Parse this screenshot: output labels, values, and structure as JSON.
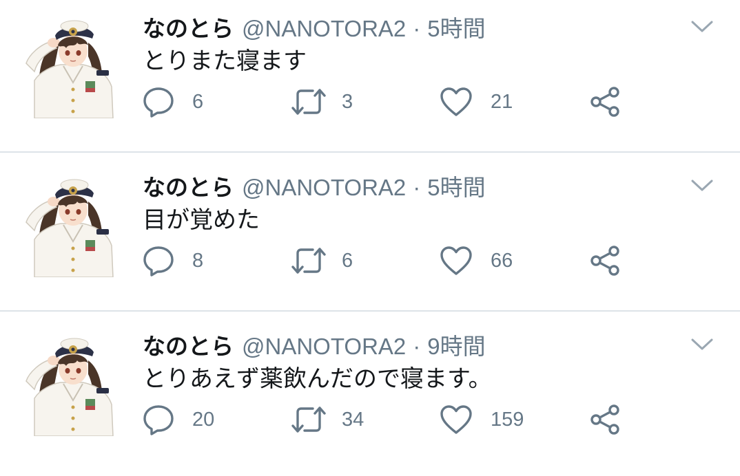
{
  "tweets": [
    {
      "name": "なのとら",
      "handle": "@NANOTORA2",
      "separator": "·",
      "time": "5時間",
      "text": "とりまた寝ます",
      "replies": "6",
      "retweets": "3",
      "likes": "21"
    },
    {
      "name": "なのとら",
      "handle": "@NANOTORA2",
      "separator": "·",
      "time": "5時間",
      "text": "目が覚めた",
      "replies": "8",
      "retweets": "6",
      "likes": "66"
    },
    {
      "name": "なのとら",
      "handle": "@NANOTORA2",
      "separator": "·",
      "time": "9時間",
      "text": "とりあえず薬飲んだので寝ます。",
      "replies": "20",
      "retweets": "34",
      "likes": "159"
    }
  ],
  "icons": {
    "reply": "reply-icon",
    "retweet": "retweet-icon",
    "like": "heart-icon",
    "share": "share-icon",
    "menu": "chevron-down-icon"
  },
  "colors": {
    "text": "#14171a",
    "secondary": "#657786",
    "divider": "#dde3e8",
    "uniform": "#f7f4ee",
    "hair": "#4a3528"
  }
}
